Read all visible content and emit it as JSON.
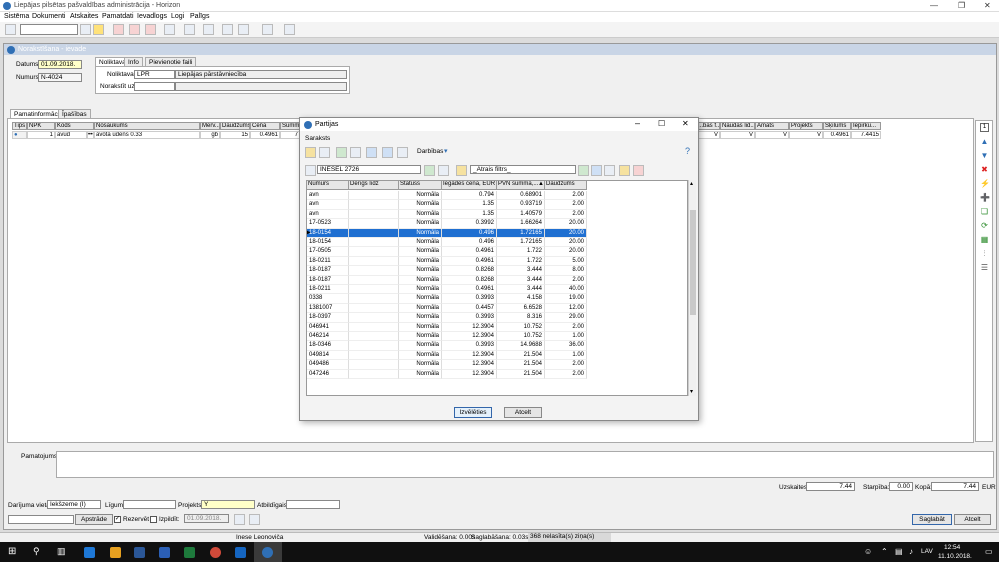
{
  "window": {
    "title": "Liepājas pilsētas pašvaldības administrācija - Horizon",
    "minimize": "—",
    "maximize": "❐",
    "close": "✕"
  },
  "menu": [
    "Sistēma",
    "Dokumenti",
    "Atskaites",
    "Pamatdati",
    "Ievadlogs",
    "Logi",
    "Palīgs"
  ],
  "doc": {
    "title": "Norakstīšana - ievade",
    "datums_label": "Datums:",
    "datums": "01.09.2018.",
    "numurs_label": "Numurs:",
    "numurs": "N-4024",
    "tabs_top": [
      "Noliktava",
      "Info",
      "Pievienotie faili"
    ],
    "noliktava_label": "Noliktava:",
    "noliktava_code": "LPR",
    "noliktava_name": "Liepājas pārstāvniecība",
    "norakstit_label": "Norakstīt uz:",
    "tabs_bottom": [
      "Pamatinformācija",
      "Īpašības"
    ]
  },
  "main_grid": {
    "headers_left": [
      "Tips",
      "NPK",
      "Kods",
      "Nosaukums",
      "Mērv...",
      "Daudzums",
      "Cena",
      "Summa"
    ],
    "headers_right": [
      "...bas f...",
      "Naudas lid...",
      "Amats",
      "Projekts",
      "Šķīlums",
      "Iepirku..."
    ],
    "row": {
      "npk": "1",
      "kods": "avud",
      "dots": "•••",
      "nosaukums": "avota ūdens 0.33",
      "merv": "gb",
      "daudzums": "15",
      "cena": "0.4961",
      "summa": "7",
      "r1": "V",
      "r2": "V",
      "r3": "V",
      "r4": "V",
      "r5": "0.4961",
      "r6": "7.4415"
    }
  },
  "dialog": {
    "title": "Partijas",
    "section": "Saraksts",
    "darbibas": "Darbības",
    "filter_value": "INESEL 2726",
    "quick_filter": "_Ātrais filtrs_",
    "headers": [
      "Numurs",
      "Derīgs līdz",
      "Statuss",
      "Iegādes cena, EUR",
      "PVN summa,...",
      "Daudzums"
    ],
    "rows": [
      [
        "avn",
        "",
        "Normāla",
        "0.794",
        "0.68901",
        "2.00"
      ],
      [
        "avn",
        "",
        "Normāla",
        "1.35",
        "0.93719",
        "2.00"
      ],
      [
        "avn",
        "",
        "Normāla",
        "1.35",
        "1.40579",
        "2.00"
      ],
      [
        "17-0523",
        "",
        "Normāla",
        "0.3992",
        "1.66264",
        "20.00"
      ],
      [
        "18-0154",
        "",
        "Normāla",
        "0.496",
        "1.72165",
        "20.00"
      ],
      [
        "18-0154",
        "",
        "Normāla",
        "0.496",
        "1.72165",
        "20.00"
      ],
      [
        "17-0505",
        "",
        "Normāla",
        "0.4961",
        "1.722",
        "20.00"
      ],
      [
        "18-0211",
        "",
        "Normāla",
        "0.4961",
        "1.722",
        "5.00"
      ],
      [
        "18-0187",
        "",
        "Normāla",
        "0.8268",
        "3.444",
        "8.00"
      ],
      [
        "18-0187",
        "",
        "Normāla",
        "0.8268",
        "3.444",
        "2.00"
      ],
      [
        "18-0211",
        "",
        "Normāla",
        "0.4961",
        "3.444",
        "40.00"
      ],
      [
        "0338",
        "",
        "Normāla",
        "0.3993",
        "4.158",
        "19.00"
      ],
      [
        "1381007",
        "",
        "Normāla",
        "0.4457",
        "6.6528",
        "12.00"
      ],
      [
        "18-0397",
        "",
        "Normāla",
        "0.3993",
        "8.316",
        "29.00"
      ],
      [
        "046941",
        "",
        "Normāla",
        "12.3904",
        "10.752",
        "2.00"
      ],
      [
        "046214",
        "",
        "Normāla",
        "12.3904",
        "10.752",
        "1.00"
      ],
      [
        "18-0346",
        "",
        "Normāla",
        "0.3993",
        "14.9688",
        "36.00"
      ],
      [
        "049814",
        "",
        "Normāla",
        "12.3904",
        "21.504",
        "1.00"
      ],
      [
        "049486",
        "",
        "Normāla",
        "12.3904",
        "21.504",
        "2.00"
      ],
      [
        "047246",
        "",
        "Normāla",
        "12.3904",
        "21.504",
        "2.00"
      ]
    ],
    "selected_index": 4,
    "ok": "Izvēlēties",
    "cancel": "Atcelt"
  },
  "bottom": {
    "pamatojums_label": "Pamatojums:",
    "uzskaites_label": "Uzskaites:",
    "uzskaites": "7.44",
    "starpiba_label": "Starpība:",
    "starpiba": "0.00",
    "kopa_label": "Kopā:",
    "kopa": "7.44",
    "currency": "EUR",
    "darijuma_label": "Darījuma vieta:",
    "darijuma_value": "Iekšzeme (I)",
    "ligums_label": "Līgums:",
    "projekts_label": "Projekts:",
    "projekts_value": "Y",
    "atbildigais_label": "Atbildīgais:",
    "apstrade": "Apstrāde",
    "rezervet": "Rezervēt",
    "izpildit": "Izpildīt:",
    "izpildit_date": "01.09.2018.",
    "saglabat": "Saglabāt",
    "atcelt": "Atcelt"
  },
  "status": {
    "user": "Inese Leonoviča",
    "validation": "Validēšana: 0.00s",
    "save": "Saglabāšana: 0.03s",
    "unread": "368 nelasīta(s) ziņa(s)"
  },
  "taskbar": {
    "lang": "LAV",
    "time": "12:54",
    "date": "11.10.2018."
  }
}
